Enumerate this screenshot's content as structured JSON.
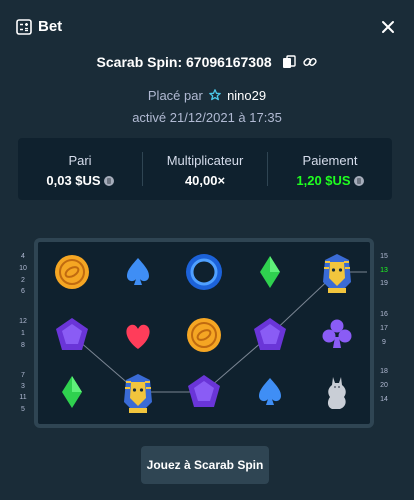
{
  "header": {
    "title": "Bet"
  },
  "game": {
    "title": "Scarab Spin: 67096167308",
    "placed_prefix": "Placé par",
    "username": "nino29",
    "activated": "activé 21/12/2021 à 17:35"
  },
  "stats": {
    "bet_label": "Pari",
    "bet_value": "0,03 $US",
    "multiplier_label": "Multiplicateur",
    "multiplier_value": "40,00×",
    "payout_label": "Paiement",
    "payout_value": "1,20 $US"
  },
  "colors": {
    "background": "#1a2c38",
    "panel": "#0f212e",
    "border": "#2f4553",
    "win_green": "#1fff20",
    "muted_text": "#b1bad3"
  },
  "reels": {
    "columns": [
      [
        "orange-coin",
        "purple-gem",
        "green-diamond"
      ],
      [
        "blue-spade",
        "red-heart",
        "pharaoh"
      ],
      [
        "blue-ring",
        "orange-coin",
        "purple-gem"
      ],
      [
        "green-diamond",
        "purple-gem",
        "blue-spade"
      ],
      [
        "pharaoh",
        "purple-club",
        "cat-statue"
      ]
    ]
  },
  "paylines": {
    "left": [
      "4",
      "10",
      "2",
      "6",
      "12",
      "1",
      "8",
      "7",
      "3",
      "11",
      "5"
    ],
    "right": [
      "15",
      "13",
      "19",
      "16",
      "17",
      "9",
      "18",
      "20",
      "14"
    ],
    "highlighted": "13"
  },
  "actions": {
    "play_label": "Jouez à Scarab Spin"
  }
}
